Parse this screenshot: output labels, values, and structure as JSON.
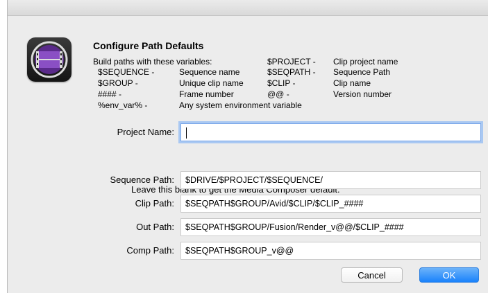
{
  "dialog": {
    "heading": "Configure Path Defaults",
    "app_icon": "media-composer-film-icon"
  },
  "variables": {
    "intro": "Build paths with these variables:",
    "left": [
      {
        "name": "$SEQUENCE -",
        "desc": "Sequence name"
      },
      {
        "name": "$GROUP -",
        "desc": "Unique clip name"
      },
      {
        "name": "#### -",
        "desc": "Frame number"
      },
      {
        "name": "%env_var% -",
        "desc": "Any system environment variable"
      }
    ],
    "right": [
      {
        "name": "$PROJECT -",
        "desc": "Clip project name"
      },
      {
        "name": "$SEQPATH -",
        "desc": "Sequence Path"
      },
      {
        "name": "$CLIP -",
        "desc": "Clip name"
      },
      {
        "name": "@@ -",
        "desc": "Version number"
      }
    ]
  },
  "project": {
    "label": "Project Name:",
    "value": "",
    "hint": "Leave this blank to get the Media Composer default."
  },
  "paths": [
    {
      "label": "Sequence Path:",
      "value": "$DRIVE/$PROJECT/$SEQUENCE/"
    },
    {
      "label": "Clip Path:",
      "value": "$SEQPATH$GROUP/Avid/$CLIP/$CLIP_####"
    },
    {
      "label": "Out Path:",
      "value": "$SEQPATH$GROUP/Fusion/Render_v@@/$CLIP_####"
    },
    {
      "label": "Comp Path:",
      "value": "$SEQPATH$GROUP_v@@"
    }
  ],
  "buttons": {
    "cancel": "Cancel",
    "ok": "OK"
  },
  "colors": {
    "ok_button": "#1a82fb",
    "focus_ring": "#a9c8f2",
    "icon_purple": "#7b3fb0"
  }
}
